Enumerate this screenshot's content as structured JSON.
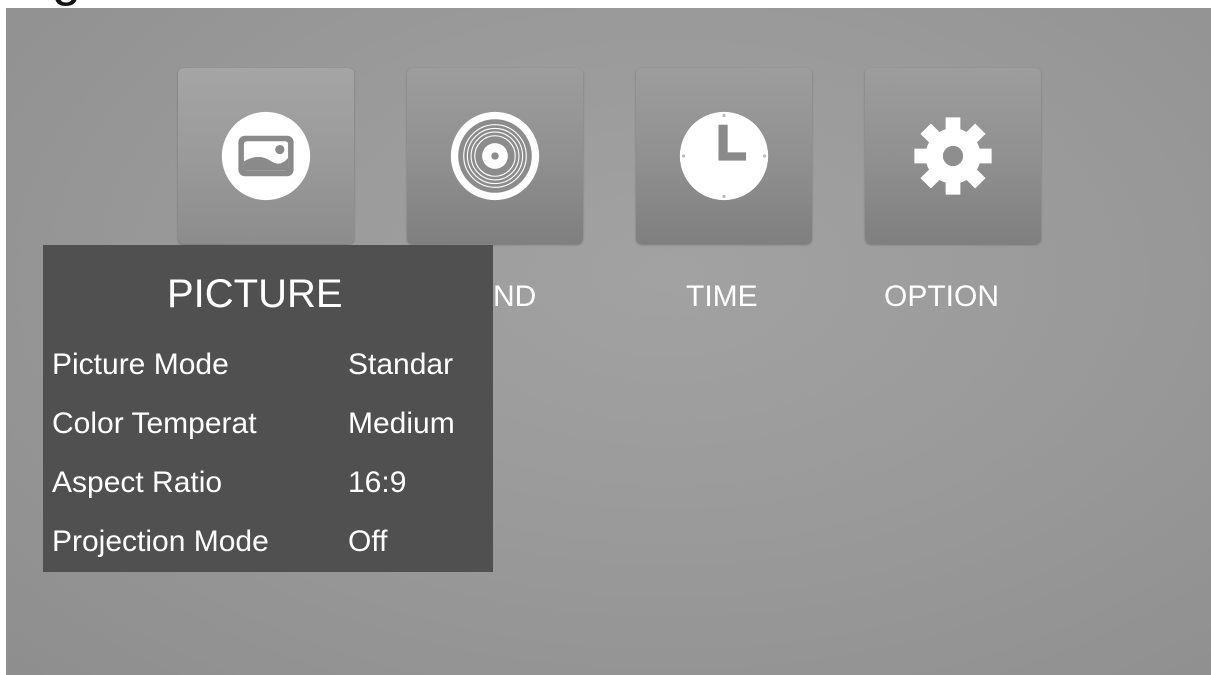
{
  "top_text": "g",
  "tabs": [
    {
      "label": "PICTURE",
      "icon": "picture-icon"
    },
    {
      "label": "SOUND",
      "icon": "disc-icon"
    },
    {
      "label": "TIME",
      "icon": "clock-icon"
    },
    {
      "label": "OPTION",
      "icon": "gear-icon"
    }
  ],
  "picture_menu": {
    "title": "PICTURE",
    "items": [
      {
        "label": "Picture Mode",
        "value": "Standar"
      },
      {
        "label": "Color Temperat",
        "value": "Medium"
      },
      {
        "label": "Aspect Ratio",
        "value": "16:9"
      },
      {
        "label": "Projection Mode",
        "value": "Off"
      }
    ]
  },
  "colors": {
    "background": "#9a9a9a",
    "panel": "#505050",
    "text": "#ffffff"
  }
}
